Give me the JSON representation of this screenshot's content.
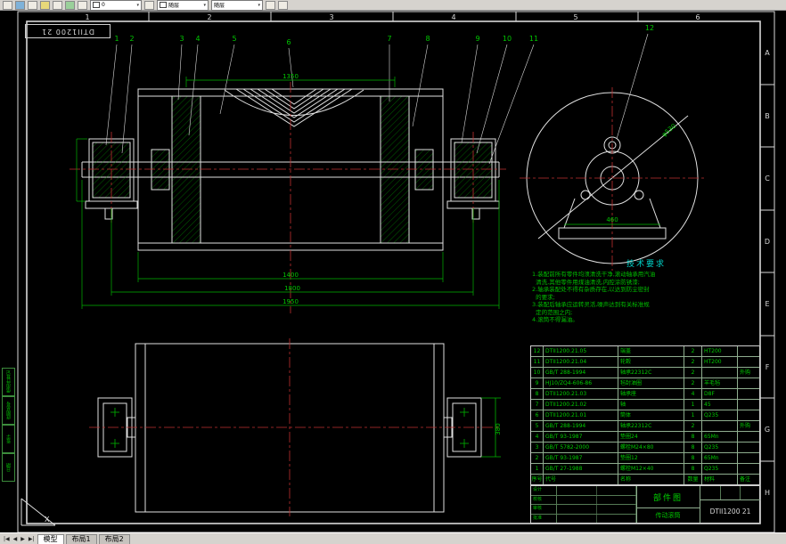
{
  "toolbar": {
    "layer_value": "0",
    "color_value": "随层",
    "linetype_value": "随层",
    "dd_arrow": "▾"
  },
  "statusbar": {
    "nav": [
      "|◀",
      "◀",
      "▶",
      "▶|"
    ],
    "tabs": [
      "模型",
      "布局1",
      "布局2"
    ]
  },
  "frame": {
    "corner_label": "DTII1200 21",
    "zones_top": [
      "1",
      "2",
      "3",
      "4",
      "5",
      "6"
    ],
    "zones_right": [
      "A",
      "B",
      "C",
      "D",
      "E",
      "F",
      "G",
      "H"
    ]
  },
  "drawing": {
    "balloons": [
      "1",
      "2",
      "3",
      "4",
      "5",
      "6",
      "7",
      "8",
      "9",
      "10",
      "11",
      "12"
    ],
    "dims": {
      "disc_span": "1350",
      "drum_length": "1400",
      "bearing_span": "1800",
      "shaft_length": "1950",
      "base_width": "460",
      "block_height": "380",
      "diagonal": "φ530"
    },
    "tech": {
      "title": "技术要求",
      "lines": [
        "1.装配前所有零件均须清洗干净,滚动轴承用汽油",
        "  清洗,其他零件用煤油清洗,内腔涂防锈漆;",
        "2.轴承装配处不得有杂质存在,以达到防尘密封",
        "  的要求;",
        "3.装配后轴承应运转灵活,噪声达到有关标准规",
        "  定的范围之内;",
        "4.滚筒不得漏油。"
      ]
    },
    "ucs_label": "X"
  },
  "bom": {
    "headers": [
      "序号",
      "代号",
      "名称",
      "数量",
      "材料",
      "备注"
    ],
    "rows": [
      {
        "no": "12",
        "code": "DTII1200.21.05",
        "name": "端盖",
        "qty": "2",
        "mat": "HT200",
        "rem": ""
      },
      {
        "no": "11",
        "code": "DTII1200.21.04",
        "name": "轮毂",
        "qty": "2",
        "mat": "HT200",
        "rem": ""
      },
      {
        "no": "10",
        "code": "GB/T 288-1994",
        "name": "轴承22312C",
        "qty": "2",
        "mat": "",
        "rem": "外购"
      },
      {
        "no": "9",
        "code": "HJ10/ZQ4-606-86",
        "name": "毡封油圈",
        "qty": "2",
        "mat": "羊毛毡",
        "rem": ""
      },
      {
        "no": "8",
        "code": "DTII1200.21.03",
        "name": "轴承座",
        "qty": "4",
        "mat": "D8F",
        "rem": ""
      },
      {
        "no": "7",
        "code": "DTII1200.21.02",
        "name": "轴",
        "qty": "1",
        "mat": "45",
        "rem": ""
      },
      {
        "no": "6",
        "code": "DTII1200.21.01",
        "name": "筒体",
        "qty": "1",
        "mat": "Q235",
        "rem": ""
      },
      {
        "no": "5",
        "code": "GB/T 288-1994",
        "name": "轴承22312C",
        "qty": "2",
        "mat": "",
        "rem": "外购"
      },
      {
        "no": "4",
        "code": "GB/T 93-1987",
        "name": "垫圈24",
        "qty": "8",
        "mat": "65Mn",
        "rem": ""
      },
      {
        "no": "3",
        "code": "GB/T 5782-2000",
        "name": "螺栓M24×80",
        "qty": "8",
        "mat": "Q235",
        "rem": ""
      },
      {
        "no": "2",
        "code": "GB/T 93-1987",
        "name": "垫圈12",
        "qty": "8",
        "mat": "65Mn",
        "rem": ""
      },
      {
        "no": "1",
        "code": "GB/T 27-1988",
        "name": "螺栓M12×40",
        "qty": "8",
        "mat": "Q235",
        "rem": ""
      }
    ]
  },
  "titleblock": {
    "doc_type": "部件图",
    "part_name": "传动滚筒",
    "drawing_no": "DTII1200 21",
    "sig_labels": [
      "设计",
      "校核",
      "审核",
      "批准"
    ]
  },
  "margin": {
    "labels": [
      "借用件登记",
      "底图总号",
      "签字",
      "日期"
    ]
  }
}
